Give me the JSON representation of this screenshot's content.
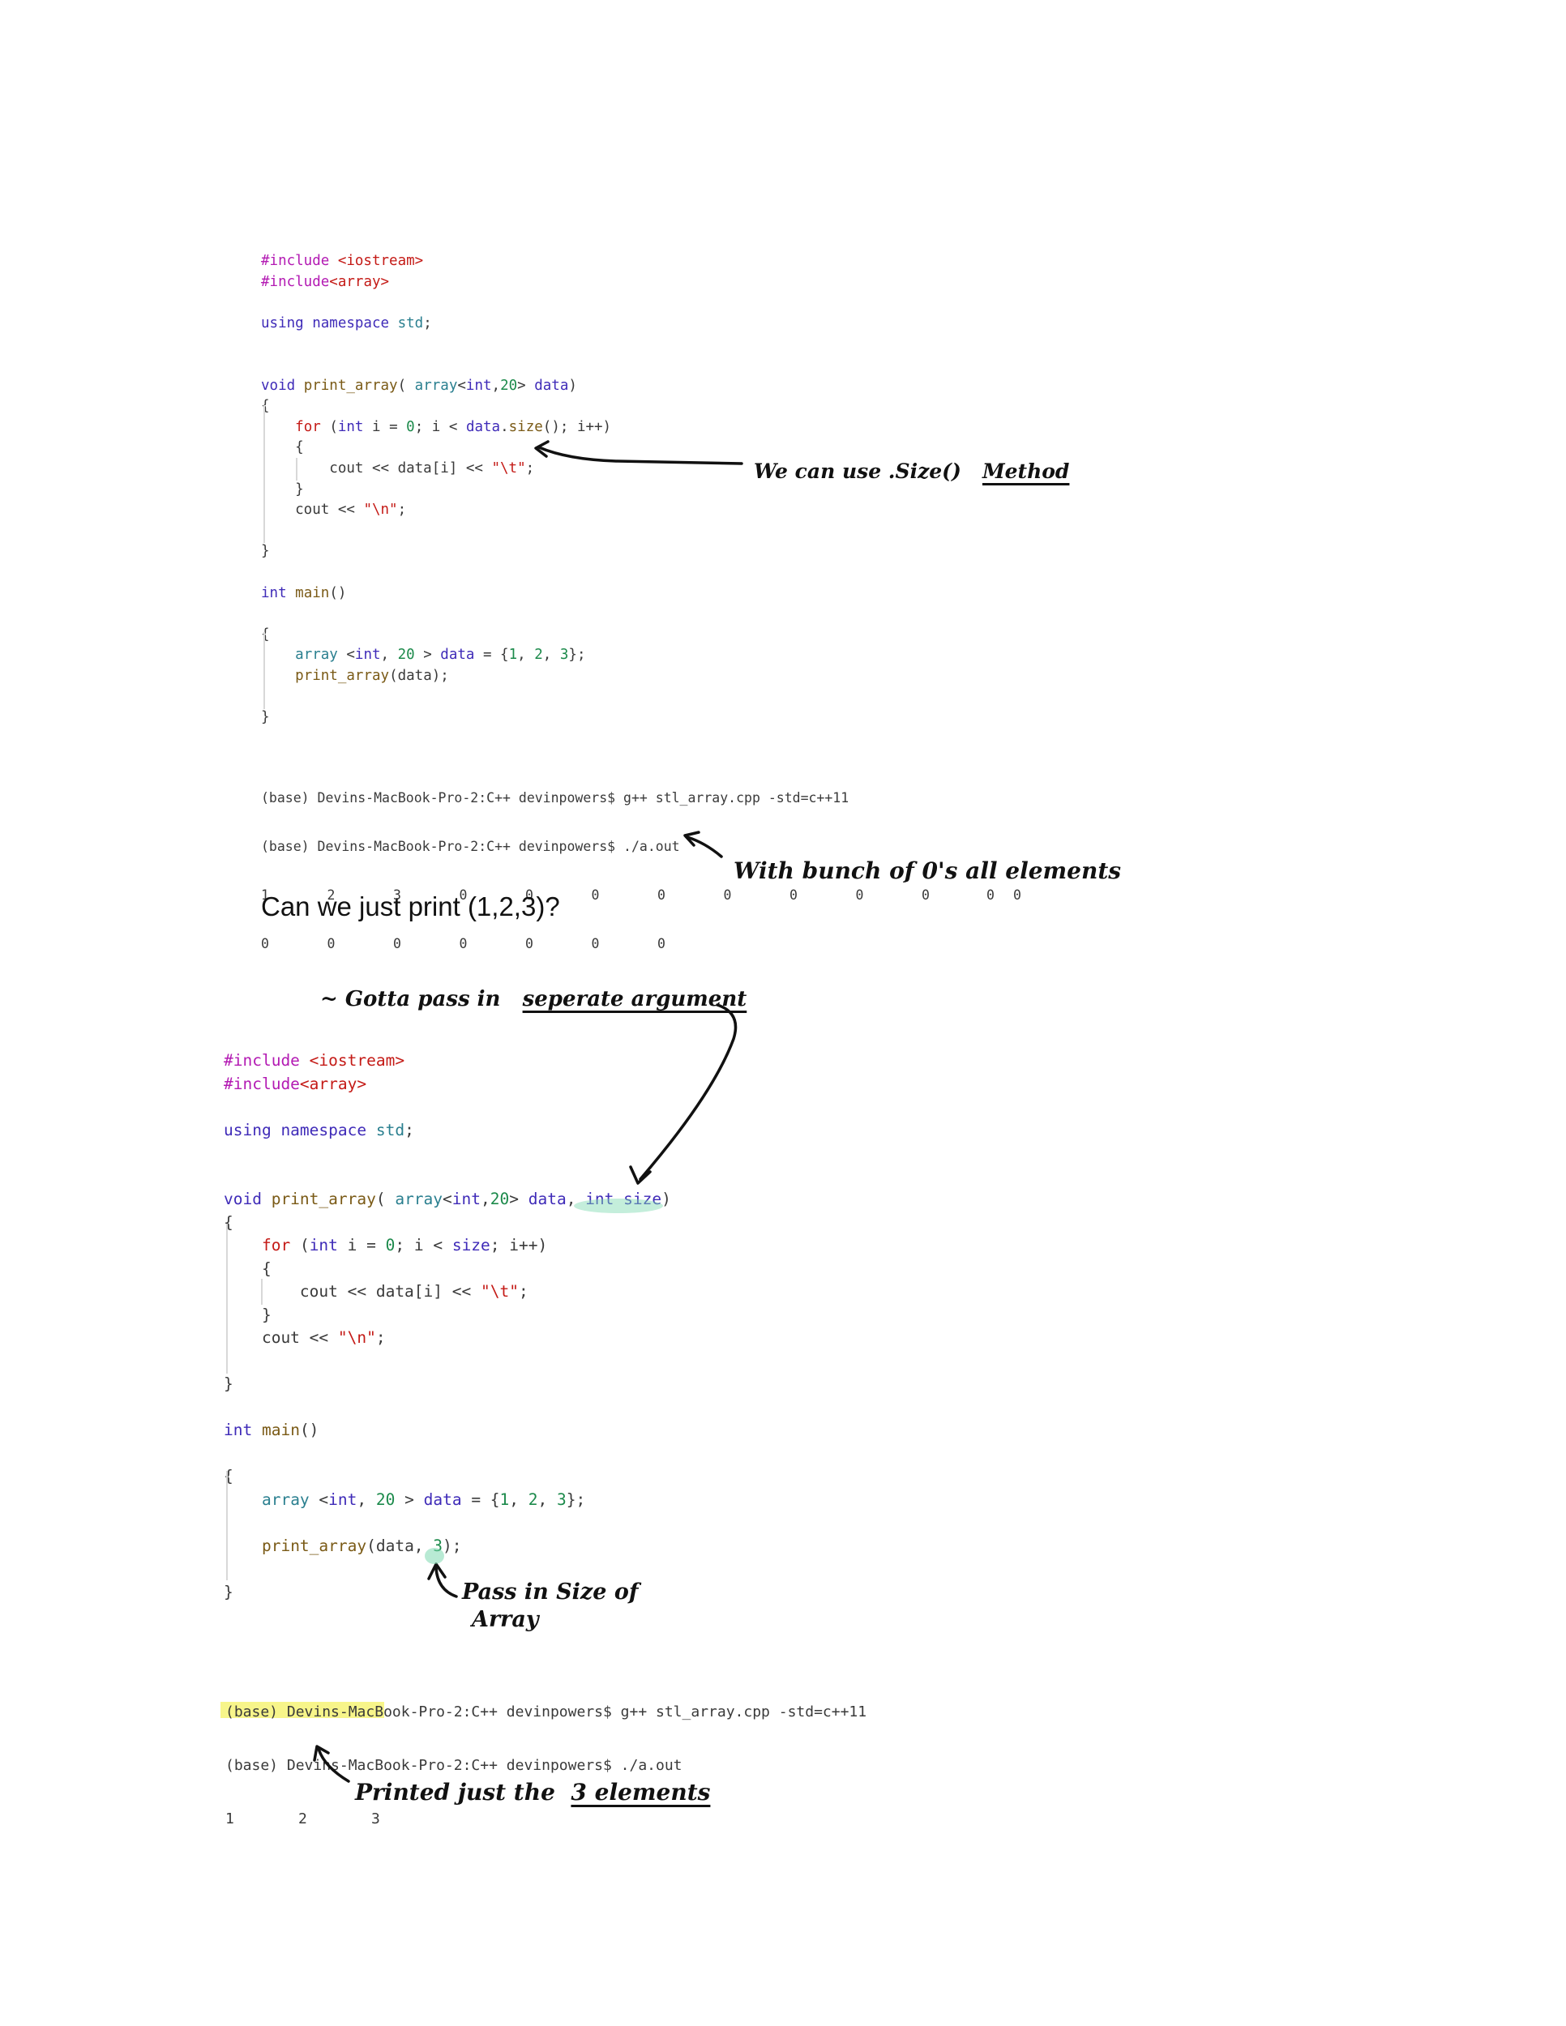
{
  "snippet1": {
    "lines": [
      [
        [
          "k-pre",
          "#include "
        ],
        [
          "k-str",
          "<iostream>"
        ]
      ],
      [
        [
          "k-pre",
          "#include"
        ],
        [
          "k-str",
          "<array>"
        ]
      ],
      [],
      [
        [
          "k-kw",
          "using namespace "
        ],
        [
          "k-type",
          "std"
        ],
        [
          "k-plain",
          ";"
        ]
      ],
      [],
      [],
      [
        [
          "k-kw",
          "void "
        ],
        [
          "k-fn",
          "print_array"
        ],
        [
          "k-plain",
          "( "
        ],
        [
          "k-type",
          "array"
        ],
        [
          "k-plain",
          "<"
        ],
        [
          "k-kw",
          "int"
        ],
        [
          "k-plain",
          ","
        ],
        [
          "k-num",
          "20"
        ],
        [
          "k-plain",
          "> "
        ],
        [
          "k-kw",
          "data"
        ],
        [
          "k-plain",
          ")"
        ]
      ],
      [
        [
          "k-plain",
          "{"
        ]
      ],
      [
        [
          "k-plain",
          "    "
        ],
        [
          "k-str",
          "for "
        ],
        [
          "k-plain",
          "("
        ],
        [
          "k-kw",
          "int "
        ],
        [
          "k-plain",
          "i = "
        ],
        [
          "k-num",
          "0"
        ],
        [
          "k-plain",
          "; i < "
        ],
        [
          "k-kw",
          "data"
        ],
        [
          "k-plain",
          "."
        ],
        [
          "k-fn",
          "size"
        ],
        [
          "k-plain",
          "(); i++)"
        ]
      ],
      [
        [
          "k-plain",
          "    {"
        ]
      ],
      [
        [
          "k-plain",
          "        cout << data[i] << "
        ],
        [
          "k-str",
          "\"\\t\""
        ],
        [
          "k-plain",
          ";"
        ]
      ],
      [
        [
          "k-plain",
          "    }"
        ]
      ],
      [
        [
          "k-plain",
          "    cout << "
        ],
        [
          "k-str",
          "\"\\n\""
        ],
        [
          "k-plain",
          ";"
        ]
      ],
      [],
      [
        [
          "k-plain",
          "}"
        ]
      ],
      [],
      [
        [
          "k-kw",
          "int "
        ],
        [
          "k-fn",
          "main"
        ],
        [
          "k-plain",
          "()"
        ]
      ],
      [],
      [
        [
          "k-plain",
          "{"
        ]
      ],
      [
        [
          "k-plain",
          "    "
        ],
        [
          "k-type",
          "array "
        ],
        [
          "k-plain",
          "<"
        ],
        [
          "k-kw",
          "int"
        ],
        [
          "k-plain",
          ", "
        ],
        [
          "k-num",
          "20"
        ],
        [
          "k-plain",
          " > "
        ],
        [
          "k-kw",
          "data"
        ],
        [
          "k-plain",
          " = {"
        ],
        [
          "k-num",
          "1"
        ],
        [
          "k-plain",
          ", "
        ],
        [
          "k-num",
          "2"
        ],
        [
          "k-plain",
          ", "
        ],
        [
          "k-num",
          "3"
        ],
        [
          "k-plain",
          "};"
        ]
      ],
      [
        [
          "k-plain",
          "    "
        ],
        [
          "k-fn",
          "print_array"
        ],
        [
          "k-plain",
          "(data);"
        ]
      ],
      [],
      [
        [
          "k-plain",
          "}"
        ]
      ]
    ]
  },
  "terminal1": {
    "prompt1": "(base) Devins-MacBook-Pro-2:C++ devinpowers$ g++ stl_array.cpp -std=c++11",
    "prompt2": "(base) Devins-MacBook-Pro-2:C++ devinpowers$ ./a.out",
    "row1": [
      "1",
      "2",
      "3",
      "0",
      "0",
      "0",
      "0",
      "0",
      "0",
      "0",
      "0",
      "0",
      "0"
    ],
    "row2": [
      "0",
      "0",
      "0",
      "0",
      "0",
      "0",
      "0"
    ]
  },
  "question": "Can we just print (1,2,3)?",
  "snippet2": {
    "lines": [
      [
        [
          "k-pre",
          "#include "
        ],
        [
          "k-str",
          "<iostream>"
        ]
      ],
      [
        [
          "k-pre",
          "#include"
        ],
        [
          "k-str",
          "<array>"
        ]
      ],
      [],
      [
        [
          "k-kw",
          "using namespace "
        ],
        [
          "k-type",
          "std"
        ],
        [
          "k-plain",
          ";"
        ]
      ],
      [],
      [],
      [
        [
          "k-kw",
          "void "
        ],
        [
          "k-fn",
          "print_array"
        ],
        [
          "k-plain",
          "( "
        ],
        [
          "k-type",
          "array"
        ],
        [
          "k-plain",
          "<"
        ],
        [
          "k-kw",
          "int"
        ],
        [
          "k-plain",
          ","
        ],
        [
          "k-num",
          "20"
        ],
        [
          "k-plain",
          "> "
        ],
        [
          "k-kw",
          "data"
        ],
        [
          "k-plain",
          ", "
        ],
        [
          "k-kw",
          "int size"
        ],
        [
          "k-plain",
          ")"
        ]
      ],
      [
        [
          "k-plain",
          "{"
        ]
      ],
      [
        [
          "k-plain",
          "    "
        ],
        [
          "k-str",
          "for "
        ],
        [
          "k-plain",
          "("
        ],
        [
          "k-kw",
          "int "
        ],
        [
          "k-plain",
          "i = "
        ],
        [
          "k-num",
          "0"
        ],
        [
          "k-plain",
          "; i < "
        ],
        [
          "k-kw",
          "size"
        ],
        [
          "k-plain",
          "; i++)"
        ]
      ],
      [
        [
          "k-plain",
          "    {"
        ]
      ],
      [
        [
          "k-plain",
          "        cout << data[i] << "
        ],
        [
          "k-str",
          "\"\\t\""
        ],
        [
          "k-plain",
          ";"
        ]
      ],
      [
        [
          "k-plain",
          "    }"
        ]
      ],
      [
        [
          "k-plain",
          "    cout << "
        ],
        [
          "k-str",
          "\"\\n\""
        ],
        [
          "k-plain",
          ";"
        ]
      ],
      [],
      [
        [
          "k-plain",
          "}"
        ]
      ],
      [],
      [
        [
          "k-kw",
          "int "
        ],
        [
          "k-fn",
          "main"
        ],
        [
          "k-plain",
          "()"
        ]
      ],
      [],
      [
        [
          "k-plain",
          "{"
        ]
      ],
      [
        [
          "k-plain",
          "    "
        ],
        [
          "k-type",
          "array "
        ],
        [
          "k-plain",
          "<"
        ],
        [
          "k-kw",
          "int"
        ],
        [
          "k-plain",
          ", "
        ],
        [
          "k-num",
          "20"
        ],
        [
          "k-plain",
          " > "
        ],
        [
          "k-kw",
          "data"
        ],
        [
          "k-plain",
          " = {"
        ],
        [
          "k-num",
          "1"
        ],
        [
          "k-plain",
          ", "
        ],
        [
          "k-num",
          "2"
        ],
        [
          "k-plain",
          ", "
        ],
        [
          "k-num",
          "3"
        ],
        [
          "k-plain",
          "};"
        ]
      ],
      [],
      [
        [
          "k-plain",
          "    "
        ],
        [
          "k-fn",
          "print_array"
        ],
        [
          "k-plain",
          "(data, "
        ],
        [
          "k-num",
          "3"
        ],
        [
          "k-plain",
          ");"
        ]
      ],
      [],
      [
        [
          "k-plain",
          "}"
        ]
      ]
    ]
  },
  "terminal2": {
    "prompt1": "(base) Devins-MacBook-Pro-2:C++ devinpowers$ g++ stl_array.cpp -std=c++11",
    "prompt2": "(base) Devins-MacBook-Pro-2:C++ devinpowers$ ./a.out",
    "row1": [
      "1",
      "2",
      "3"
    ]
  },
  "notes": {
    "size_method_prefix": "We can use .Size()",
    "size_method_word": "Method",
    "zeros": "With bunch of 0's all elements",
    "gotta_prefix": "~ Gotta pass in",
    "gotta_underlined": "seperate argument",
    "pass_size_line1": "Pass in Size of",
    "pass_size_line2": "Array",
    "printed_prefix": "Printed just the",
    "printed_underlined": "3 elements"
  }
}
